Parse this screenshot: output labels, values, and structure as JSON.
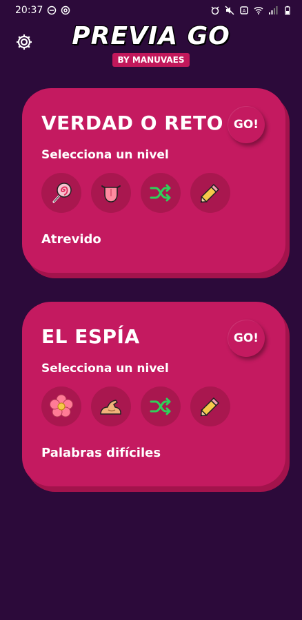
{
  "status_bar": {
    "time": "20:37"
  },
  "app": {
    "title": "PREVIA GO",
    "subtitle": "BY MANUVAES"
  },
  "games": [
    {
      "title": "VERDAD O RETO",
      "go_label": "GO!",
      "level_prompt": "Selecciona un nivel",
      "levels": [
        "lollipop-icon",
        "tongue-icon",
        "shuffle-icon",
        "pencil-icon"
      ],
      "selected_level": "Atrevido"
    },
    {
      "title": "EL ESPÍA",
      "go_label": "GO!",
      "level_prompt": "Selecciona un nivel",
      "levels": [
        "flower-icon",
        "flexed-biceps-icon",
        "shuffle-icon",
        "pencil-icon"
      ],
      "selected_level": "Palabras difíciles"
    }
  ],
  "colors": {
    "background": "#2c0a3a",
    "card": "#c41a60",
    "card_shadow": "#a3134c",
    "badge": "#c2185b"
  }
}
